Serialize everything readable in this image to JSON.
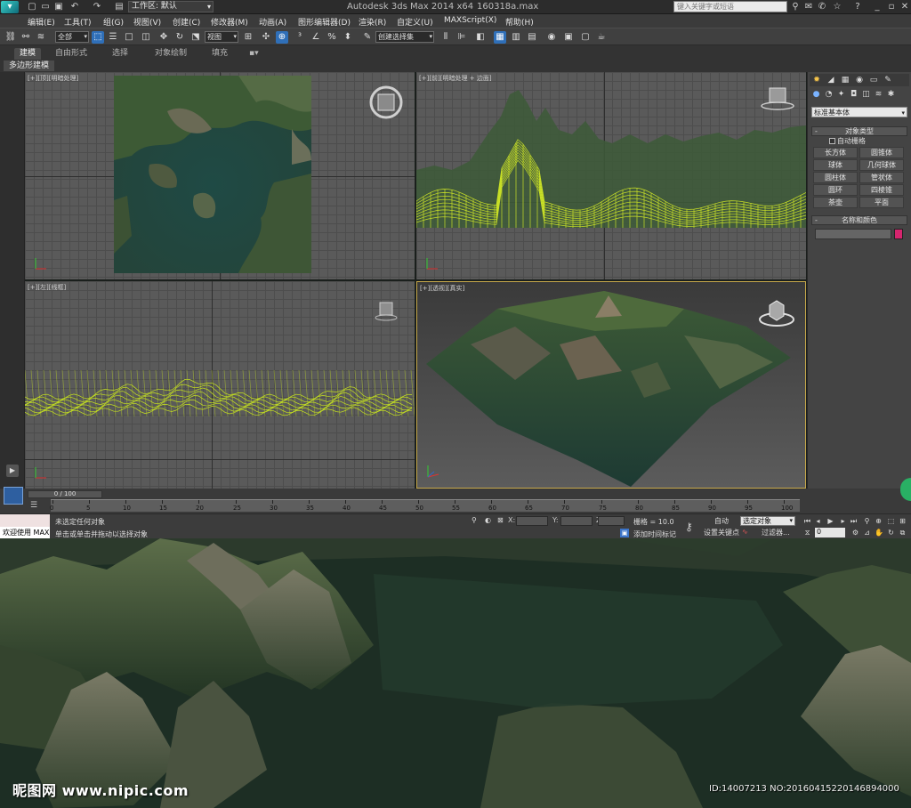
{
  "titlebar": {
    "app_title": "Autodesk 3ds Max  2014 x64",
    "file_title": "160318a.max",
    "workspace_label": "工作区: 默认",
    "search_placeholder": "键入关键字或短语"
  },
  "menu": [
    "编辑(E)",
    "工具(T)",
    "组(G)",
    "视图(V)",
    "创建(C)",
    "修改器(M)",
    "动画(A)",
    "图形编辑器(D)",
    "渲染(R)",
    "自定义(U)",
    "MAXScript(X)",
    "帮助(H)"
  ],
  "toolbar": {
    "selection_filter": "全部",
    "ref_coord": "视图",
    "named_selection": "创建选择集"
  },
  "ribbon": {
    "tabs": [
      "建模",
      "自由形式",
      "选择",
      "对象绘制",
      "填充"
    ],
    "active_tab": "建模",
    "subpanel": "多边形建模"
  },
  "viewports": {
    "top": "[+][顶][明暗处理]",
    "front": "[+][前][明暗处理 + 边面]",
    "left": "[+][左][线框]",
    "persp": "[+][透视][真实]"
  },
  "command_panel": {
    "category": "标准基本体",
    "object_type_title": "对象类型",
    "autogrid": "自动栅格",
    "objects": [
      "长方体",
      "圆锥体",
      "球体",
      "几何球体",
      "圆柱体",
      "管状体",
      "圆环",
      "四棱锥",
      "茶壶",
      "平面"
    ],
    "name_color_title": "名称和颜色",
    "object_color": "#d6256e"
  },
  "timeline": {
    "frame_counter": "0 / 100",
    "ticks": [
      "0",
      "5",
      "10",
      "15",
      "20",
      "25",
      "30",
      "35",
      "40",
      "45",
      "50",
      "55",
      "60",
      "65",
      "70",
      "75",
      "80",
      "85",
      "90",
      "95",
      "100"
    ]
  },
  "status": {
    "welcome": "欢迎使用 MAX",
    "selection_info": "未选定任何对象",
    "prompt": "单击或单击并拖动以选择对象",
    "x_label": "X:",
    "y_label": "Y:",
    "z_label": "Z:",
    "grid": "栅格 = 10.0",
    "add_time_tag": "添加时间标记",
    "auto_key": "自动",
    "set_key": "设置关键点",
    "selected_set": "选定对象",
    "filters": "过滤器...",
    "frame": "0"
  },
  "watermark": {
    "site": "昵图网 www.nipic.com",
    "id": "ID:14007213 NO:20160415220146894000"
  }
}
